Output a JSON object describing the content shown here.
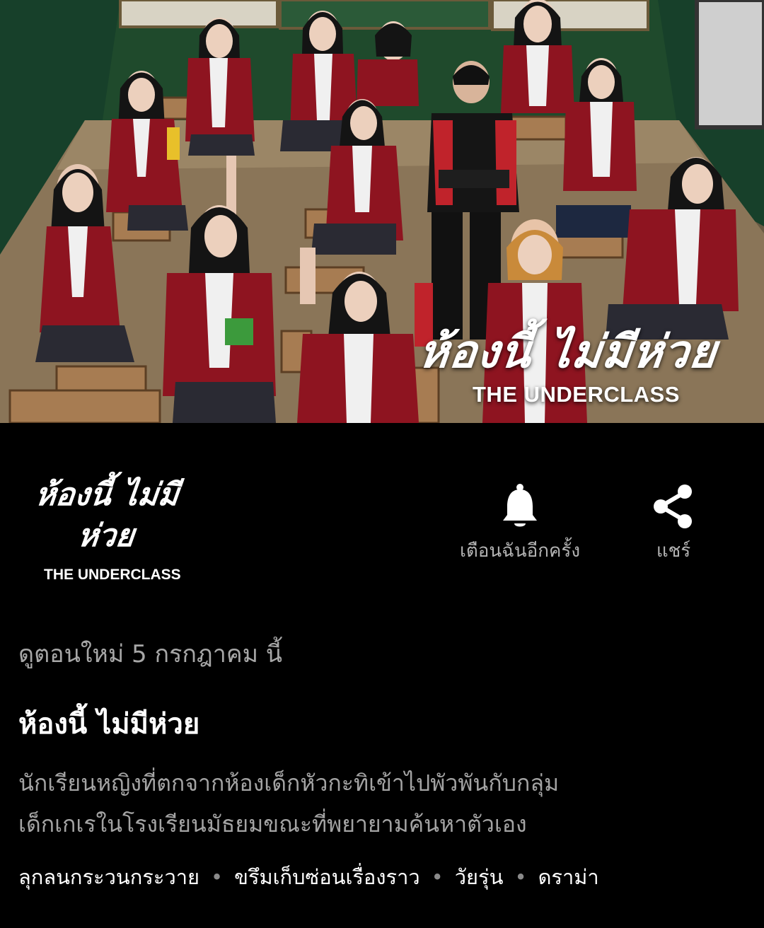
{
  "hero": {
    "logo_title": "ห้องนี้ ไม่มีห่วย",
    "logo_subtitle": "THE UNDERCLASS"
  },
  "show_logo": {
    "line1": "ห้องนี้ ไม่มี",
    "line2": "ห่วย",
    "line3": "THE UNDERCLASS"
  },
  "actions": {
    "remind": {
      "label": "เตือนฉันอีกครั้ง",
      "icon": "bell-icon"
    },
    "share": {
      "label": "แชร์",
      "icon": "share-icon"
    }
  },
  "details": {
    "coming_text": "ดูตอนใหม่ 5 กรกฎาคม นี้",
    "title": "ห้องนี้ ไม่มีห่วย",
    "synopsis_line1": "นักเรียนหญิงที่ตกจากห้องเด็กหัวกะทิเข้าไปพัวพันกับกลุ่ม",
    "synopsis_line2": "เด็กเกเรในโรงเรียนมัธยมขณะที่พยายามค้นหาตัวเอง",
    "genres": [
      "ลุกลนกระวนกระวาย",
      "ขรึมเก็บซ่อนเรื่องราว",
      "วัยรุ่น",
      "ดราม่า"
    ],
    "separator": "•"
  },
  "colors": {
    "background": "#000000",
    "muted_text": "#a7a7a7",
    "blazer": "#8e1420",
    "chalkboard": "#1f4a2c"
  }
}
